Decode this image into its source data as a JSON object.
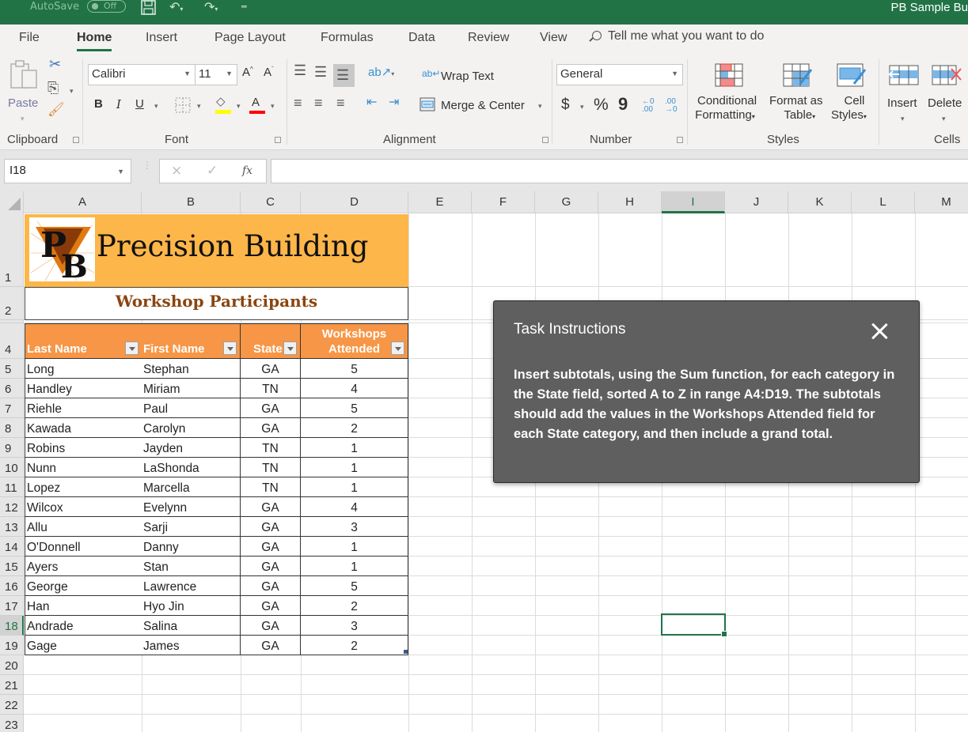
{
  "titlebar": {
    "autosave_label": "AutoSave",
    "autosave_state": "Off",
    "document_title": "PB Sample Bu"
  },
  "menu_tabs": [
    {
      "label": "File",
      "active": false
    },
    {
      "label": "Home",
      "active": true
    },
    {
      "label": "Insert",
      "active": false
    },
    {
      "label": "Page Layout",
      "active": false
    },
    {
      "label": "Formulas",
      "active": false
    },
    {
      "label": "Data",
      "active": false
    },
    {
      "label": "Review",
      "active": false
    },
    {
      "label": "View",
      "active": false
    }
  ],
  "tell_me": {
    "placeholder": "Tell me what you want to do",
    "icon": "search-icon"
  },
  "ribbon": {
    "clipboard": {
      "label": "Clipboard",
      "paste": "Paste",
      "cut_icon": "scissors-icon",
      "copy_icon": "copy-icon",
      "format_painter_icon": "paintbrush-icon"
    },
    "font": {
      "label": "Font",
      "font_name": "Calibri",
      "font_size": "11",
      "bold": "B",
      "italic": "I",
      "underline": "U",
      "grow": "A",
      "shrink": "A",
      "fill_color": "#ffff00",
      "font_color": "#ff0000"
    },
    "alignment": {
      "label": "Alignment",
      "wrap_text": "Wrap Text",
      "merge_center": "Merge & Center"
    },
    "number": {
      "label": "Number",
      "format": "General",
      "currency": "$",
      "percent": "%",
      "comma": "9",
      "inc_decimal": "←.0 .00",
      "dec_decimal": ".00 →.0"
    },
    "styles": {
      "label": "Styles",
      "conditional_formatting": [
        "Conditional",
        "Formatting"
      ],
      "format_as_table": [
        "Format as",
        "Table"
      ],
      "cell_styles": [
        "Cell",
        "Styles"
      ]
    },
    "cells": {
      "label": "Cells",
      "insert": "Insert",
      "delete": "Delete"
    }
  },
  "formula_bar": {
    "name_box": "I18",
    "cancel_icon": "×",
    "enter_icon": "✓",
    "fx_label": "fx",
    "formula": ""
  },
  "columns": [
    "A",
    "B",
    "C",
    "D",
    "E",
    "F",
    "G",
    "H",
    "I",
    "J",
    "K",
    "L",
    "M"
  ],
  "selected_column": "I",
  "rows_visible": [
    "1",
    "2",
    "4",
    "5",
    "6",
    "7",
    "8",
    "9",
    "10",
    "11",
    "12",
    "13",
    "14",
    "15",
    "16",
    "17",
    "18",
    "19",
    "20",
    "21",
    "22",
    "23"
  ],
  "selected_row": "18",
  "selected_cell": "I18",
  "sheet": {
    "banner_title": "Precision Building",
    "logo_text": "PB",
    "subtitle": "Workshop Participants",
    "headers": [
      "Last Name",
      "First Name",
      "State",
      "Workshops Attended"
    ],
    "header_lines": {
      "workshops_1": "Workshops",
      "workshops_2": "Attended"
    },
    "rows": [
      {
        "row": "5",
        "last": "Long",
        "first": "Stephan",
        "state": "GA",
        "workshops": "5"
      },
      {
        "row": "6",
        "last": "Handley",
        "first": "Miriam",
        "state": "TN",
        "workshops": "4"
      },
      {
        "row": "7",
        "last": "Riehle",
        "first": "Paul",
        "state": "GA",
        "workshops": "5"
      },
      {
        "row": "8",
        "last": "Kawada",
        "first": "Carolyn",
        "state": "GA",
        "workshops": "2"
      },
      {
        "row": "9",
        "last": "Robins",
        "first": "Jayden",
        "state": "TN",
        "workshops": "1"
      },
      {
        "row": "10",
        "last": "Nunn",
        "first": "LaShonda",
        "state": "TN",
        "workshops": "1"
      },
      {
        "row": "11",
        "last": "Lopez",
        "first": "Marcella",
        "state": "TN",
        "workshops": "1"
      },
      {
        "row": "12",
        "last": "Wilcox",
        "first": "Evelynn",
        "state": "GA",
        "workshops": "4"
      },
      {
        "row": "13",
        "last": "Allu",
        "first": "Sarji",
        "state": "GA",
        "workshops": "3"
      },
      {
        "row": "14",
        "last": "O'Donnell",
        "first": "Danny",
        "state": "GA",
        "workshops": "1"
      },
      {
        "row": "15",
        "last": "Ayers",
        "first": "Stan",
        "state": "GA",
        "workshops": "1"
      },
      {
        "row": "16",
        "last": "George",
        "first": "Lawrence",
        "state": "GA",
        "workshops": "5"
      },
      {
        "row": "17",
        "last": "Han",
        "first": "Hyo Jin",
        "state": "GA",
        "workshops": "2"
      },
      {
        "row": "18",
        "last": "Andrade",
        "first": "Salina",
        "state": "GA",
        "workshops": "3"
      },
      {
        "row": "19",
        "last": "Gage",
        "first": "James",
        "state": "GA",
        "workshops": "2"
      }
    ]
  },
  "task_panel": {
    "title": "Task Instructions",
    "body": "Insert subtotals, using the Sum function, for each category in the State field, sorted A to Z in range A4:D19. The subtotals should add the values in the Workshops Attended field for each State category, and then include a grand total."
  },
  "colors": {
    "excel_green": "#217346",
    "banner_orange": "#fdb649",
    "header_orange": "#f79646",
    "subtitle_brown": "#8a4510",
    "task_panel_bg": "#5f5f5f"
  }
}
